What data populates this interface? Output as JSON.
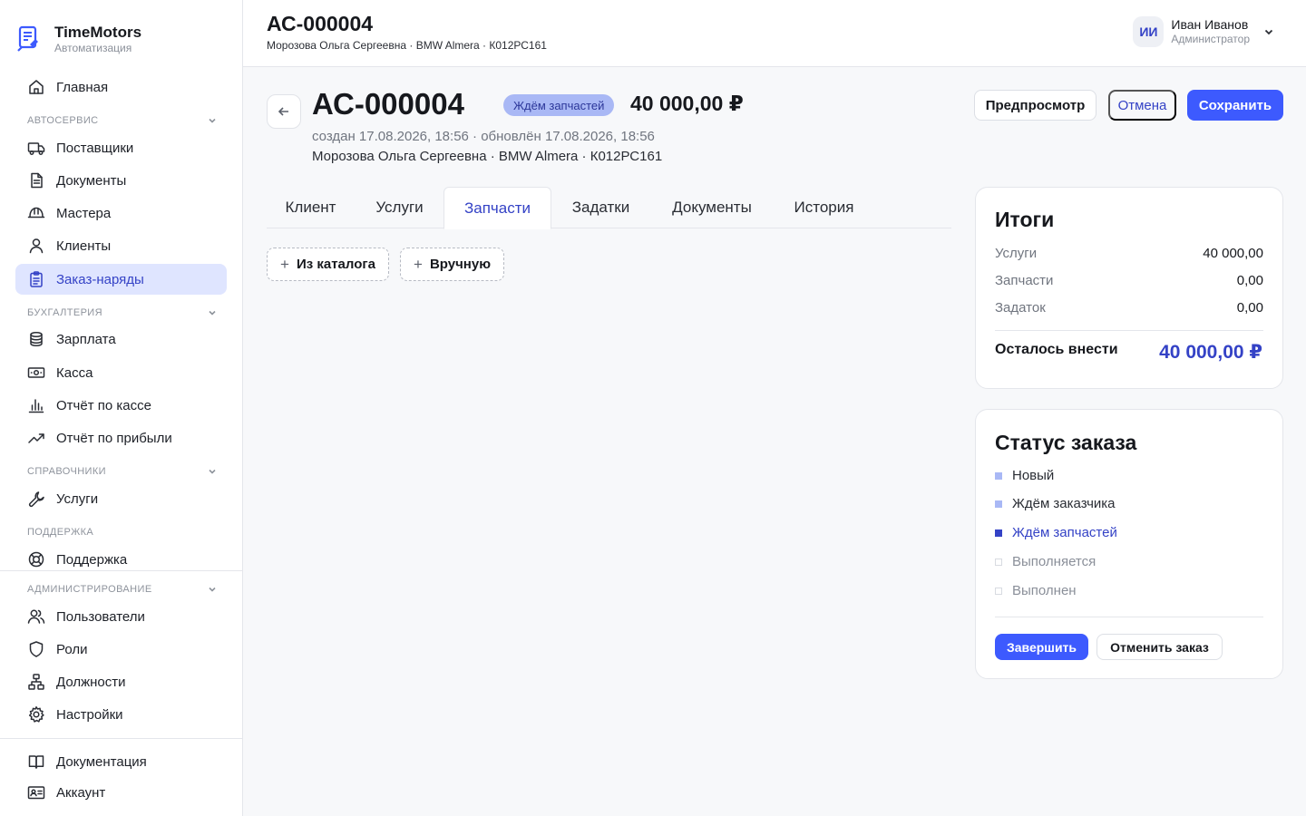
{
  "app": {
    "name": "TimeMotors",
    "subtitle": "Автоматизация"
  },
  "sidebar": {
    "home": "Главная",
    "sections": {
      "autoservice": "АВТОСЕРВИС",
      "accounting": "БУХГАЛТЕРИЯ",
      "references": "СПРАВОЧНИКИ",
      "support": "ПОДДЕРЖКА",
      "admin": "АДМИНИСТРИРОВАНИЕ"
    },
    "items": {
      "suppliers": "Поставщики",
      "documents": "Документы",
      "masters": "Мастера",
      "clients": "Клиенты",
      "orders": "Заказ-наряды",
      "salary": "Зарплата",
      "cash": "Касса",
      "cash_report": "Отчёт по кассе",
      "profit_report": "Отчёт по прибыли",
      "services": "Услуги",
      "support": "Поддержка",
      "users": "Пользователи",
      "roles": "Роли",
      "positions": "Должности",
      "settings": "Настройки",
      "docs": "Документация",
      "account": "Аккаунт"
    },
    "active_item": "orders"
  },
  "topbar": {
    "title": "АС-000004",
    "subtitle": "Морозова Ольга Сергеевна · BMW Almera · К012РС161"
  },
  "user": {
    "initials": "ИИ",
    "name": "Иван Иванов",
    "role": "Администратор"
  },
  "order": {
    "number": "АС-000004",
    "status": "Ждём запчастей",
    "amount": "40 000,00 ₽",
    "dates": "создан 17.08.2026, 18:56 · обновлён 17.08.2026, 18:56",
    "client_line": "Морозова Ольга Сергеевна · BMW Almera · К012РС161"
  },
  "actions": {
    "preview": "Предпросмотр",
    "cancel": "Отмена",
    "save": "Сохранить"
  },
  "tabs": [
    "Клиент",
    "Услуги",
    "Запчасти",
    "Задатки",
    "Документы",
    "История"
  ],
  "active_tab": "Запчасти",
  "parts": {
    "from_catalog": "Из каталога",
    "manual": "Вручную"
  },
  "totals": {
    "title": "Итоги",
    "rows": [
      {
        "label": "Услуги",
        "value": "40 000,00"
      },
      {
        "label": "Запчасти",
        "value": "0,00"
      },
      {
        "label": "Задаток",
        "value": "0,00"
      }
    ],
    "remaining_label": "Осталось внести",
    "remaining_value": "40 000,00 ₽"
  },
  "order_status": {
    "title": "Статус заказа",
    "steps": [
      {
        "label": "Новый",
        "state": "done"
      },
      {
        "label": "Ждём заказчика",
        "state": "done"
      },
      {
        "label": "Ждём запчастей",
        "state": "current"
      },
      {
        "label": "Выполняется",
        "state": "todo"
      },
      {
        "label": "Выполнен",
        "state": "todo"
      }
    ],
    "complete_button": "Завершить",
    "cancel_button": "Отменить заказ"
  },
  "colors": {
    "accent": "#3d5afe",
    "accent_text": "#3442c6",
    "status_pill_bg": "#a9b8f5",
    "active_nav_bg": "#dfe5ff"
  }
}
